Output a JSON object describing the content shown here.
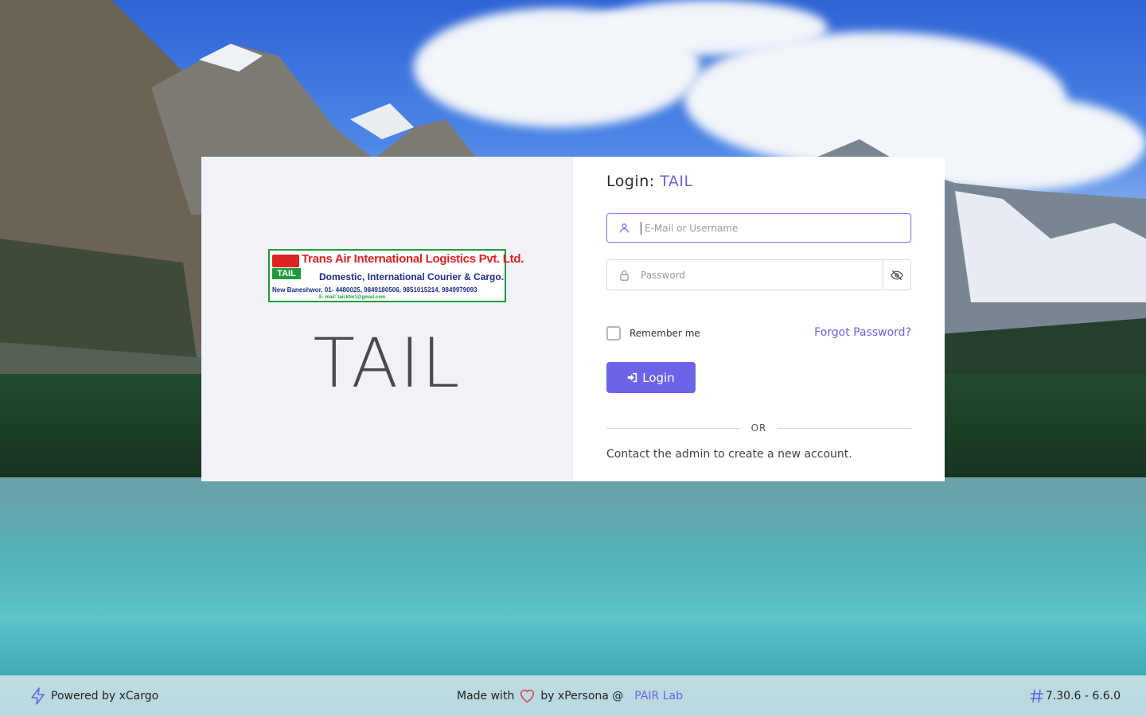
{
  "colors": {
    "accent": "#6c63e8",
    "brand_panel_bg": "#f0f2f8"
  },
  "brand": {
    "logo": {
      "line1": "Trans Air International Logistics Pvt. Ltd.",
      "tag": "TAIL",
      "line2": "Domestic, International Courier & Cargo.",
      "line3": "New Baneshwor, 01- 4480025, 9849180506, 9851015214, 9849979093",
      "line4": "E- mail: tail.ktm1@gmail.com"
    },
    "name": "TAIL"
  },
  "login": {
    "title_prefix": "Login:",
    "title_org": "TAIL",
    "username": {
      "placeholder": "E-Mail or Username",
      "icon": "user-icon"
    },
    "password": {
      "placeholder": "Password",
      "icon": "lock-icon",
      "toggle_icon": "eye-off-icon"
    },
    "remember_label": "Remember me",
    "remember_checked": false,
    "forgot_label": "Forgot Password?",
    "login_label": "Login",
    "login_icon": "sign-in-icon",
    "or_label": "OR",
    "contact_text": "Contact the admin to create a new account."
  },
  "footer": {
    "powered": "Powered by xCargo",
    "made_with": "Made with",
    "by": "by xPersona @",
    "lab": "PAIR Lab",
    "version": "7.30.6 - 6.6.0"
  }
}
